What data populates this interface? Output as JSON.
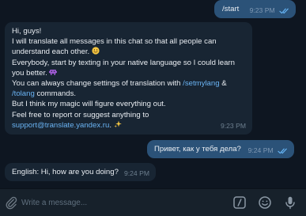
{
  "messages": {
    "start": {
      "text": "/start",
      "time": "9:23 PM"
    },
    "bot_intro": {
      "line1": "Hi, guys!",
      "line2": "I will translate all messages in this chat so that all people can",
      "line3": "understand each other.",
      "line4": "Everybody, start by texting in your native language so I could learn",
      "line5": "you better.",
      "line6_prefix": "You can always change settings of translation with ",
      "line6_link": "/setmylang",
      "line6_suffix": " &",
      "line7_link": "/tolang",
      "line7_suffix": " commands.",
      "line8": "But I think my magic will figure everything out.",
      "line9": "Feel free to report or suggest anything to",
      "line10_link": "support@translate.yandex.ru",
      "line10_suffix": ".",
      "time": "9:23 PM"
    },
    "user_russian": {
      "text": "Привет, как у тебя дела?",
      "time": "9:24 PM"
    },
    "translation": {
      "text": "English: Hi, how are you doing?",
      "time": "9:24 PM"
    }
  },
  "composer": {
    "placeholder": "Write a message...",
    "icons": [
      "attach-icon",
      "bot-commands-icon",
      "emoji-icon",
      "microphone-icon"
    ]
  },
  "colors": {
    "background": "#0e1621",
    "outgoing_bubble": "#2b5278",
    "incoming_bubble": "#182533",
    "link": "#6ab3f3",
    "check": "#64b2f2",
    "composer": "#17212b"
  }
}
